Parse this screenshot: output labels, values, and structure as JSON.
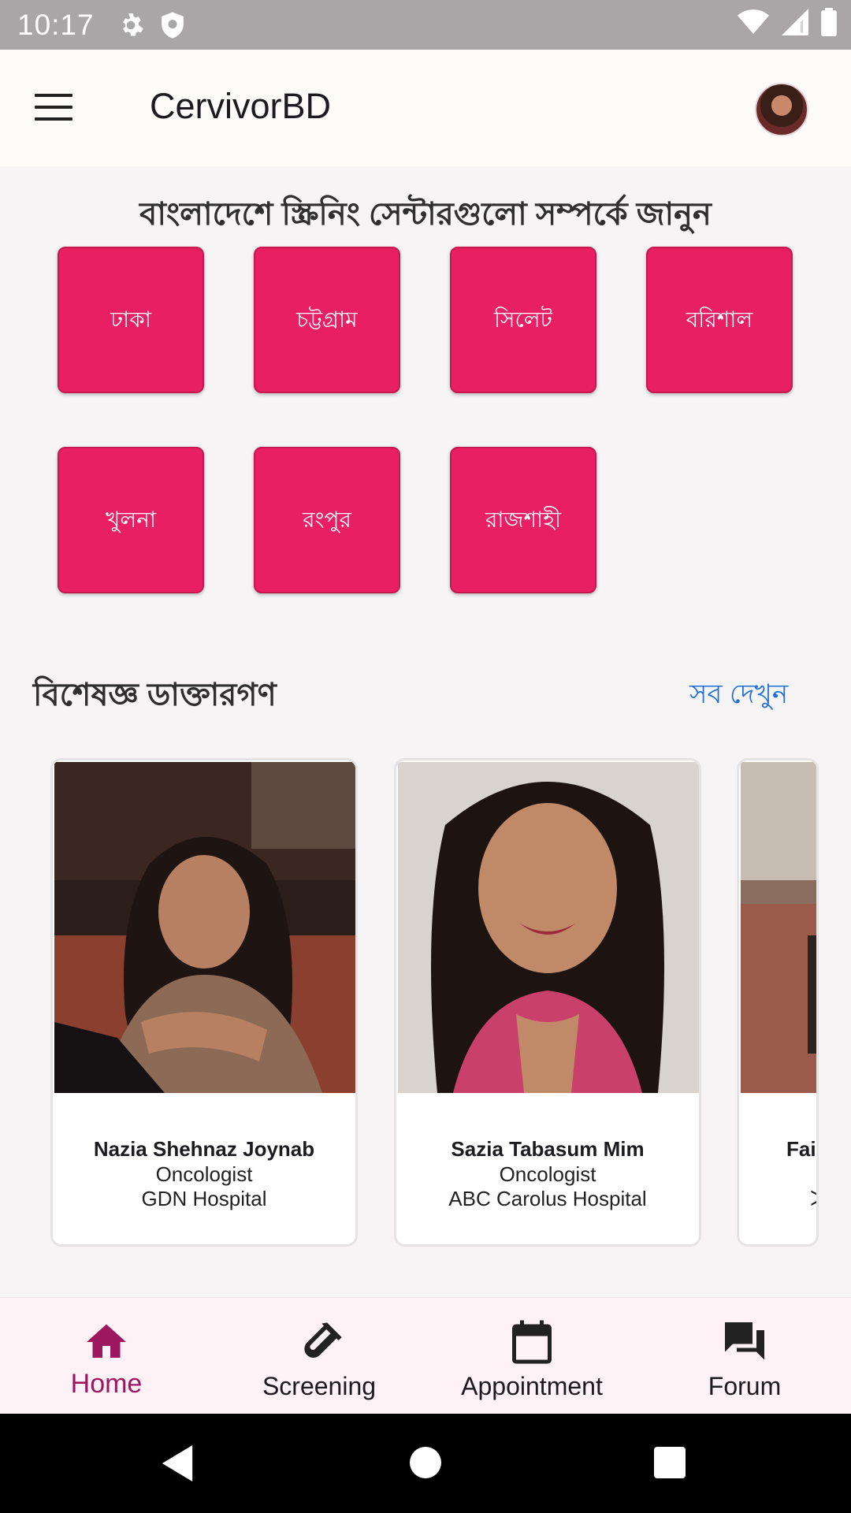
{
  "status_bar": {
    "time": "10:17",
    "icons": [
      "settings-icon",
      "shield-icon",
      "wifi-icon",
      "signal-icon",
      "battery-icon"
    ]
  },
  "app_bar": {
    "title": "CervivorBD",
    "menu_icon": "hamburger-menu-icon",
    "avatar": "user-avatar"
  },
  "screening": {
    "title": "বাংলাদেশে স্ক্রিনিং সেন্টারগুলো সম্পর্কে জানুন",
    "divisions": [
      "ঢাকা",
      "চট্টগ্রাম",
      "সিলেট",
      "বরিশাল",
      "খুলনা",
      "রংপুর",
      "রাজশাহী"
    ]
  },
  "doctors": {
    "heading": "বিশেষজ্ঞ ডাক্তারগণ",
    "see_all": "সব দেখুন",
    "cards": [
      {
        "name": "Nazia Shehnaz Joynab",
        "specialty": "Oncologist",
        "hospital": "GDN Hospital"
      },
      {
        "name": "Sazia Tabasum Mim",
        "specialty": "Oncologist",
        "hospital": "ABC Carolus Hospital"
      },
      {
        "name": "Fai",
        "specialty": "",
        "hospital": "ᐳ"
      }
    ]
  },
  "bottom_nav": [
    {
      "label": "Home",
      "icon": "home-icon",
      "active": true
    },
    {
      "label": "Screening",
      "icon": "test-tube-icon",
      "active": false
    },
    {
      "label": "Appointment",
      "icon": "calendar-icon",
      "active": false
    },
    {
      "label": "Forum",
      "icon": "forum-icon",
      "active": false
    }
  ],
  "colors": {
    "accent": "#e81f63",
    "nav_active": "#9c1660",
    "link": "#1e6fd6"
  }
}
